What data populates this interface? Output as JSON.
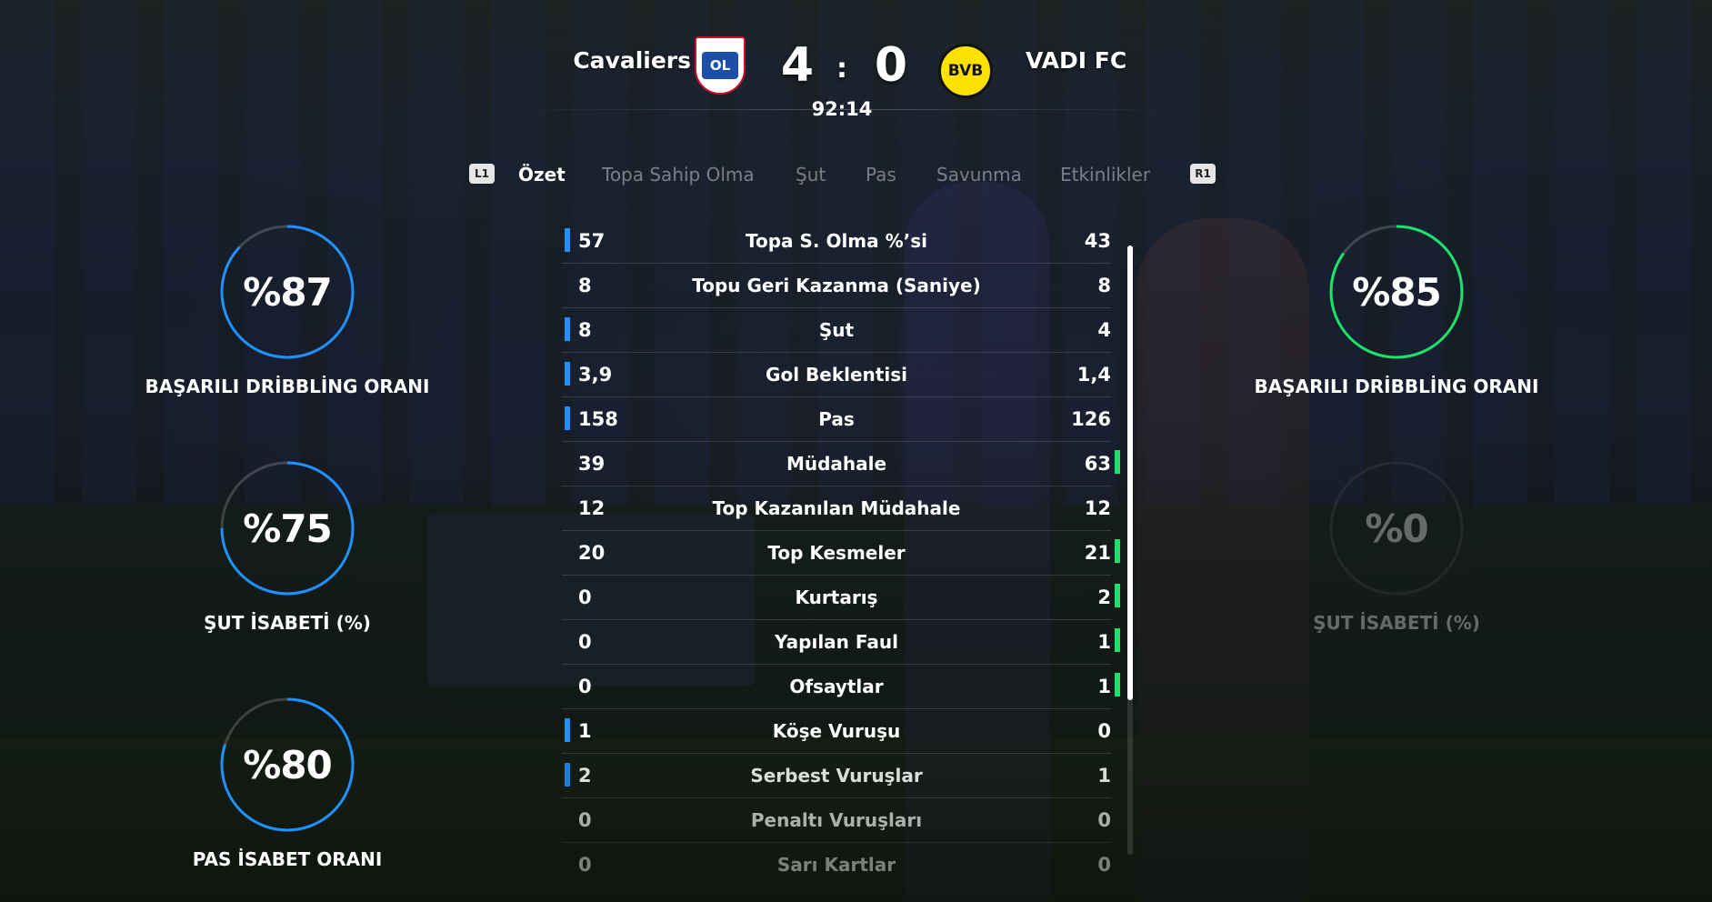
{
  "match": {
    "home_team": "Cavaliers",
    "home_crest_text": "OL",
    "home_score": "4",
    "separator": ":",
    "away_score": "0",
    "away_crest_text": "BVB",
    "away_team": "VADI FC",
    "clock": "92:14"
  },
  "tabs": {
    "left_hint": "L1",
    "right_hint": "R1",
    "items": [
      "Özet",
      "Topa Sahip Olma",
      "Şut",
      "Pas",
      "Savunma",
      "Etkinlikler"
    ],
    "active_index": 0
  },
  "home_rings": [
    {
      "value": "%87",
      "label": "BAŞARILI DRİBBLİNG ORANI",
      "fraction": 0.87
    },
    {
      "value": "%75",
      "label": "ŞUT İSABETİ (%)",
      "fraction": 0.75
    },
    {
      "value": "%80",
      "label": "PAS İSABET ORANI",
      "fraction": 0.8
    }
  ],
  "away_rings": [
    {
      "value": "%85",
      "label": "BAŞARILI DRİBBLİNG ORANI",
      "fraction": 0.85
    },
    {
      "value": "%0",
      "label": "ŞUT İSABETİ (%)",
      "fraction": 0.0
    }
  ],
  "stats": [
    {
      "label": "Topa S. Olma %’si",
      "home": "57",
      "away": "43",
      "leader": "home"
    },
    {
      "label": "Topu Geri Kazanma (Saniye)",
      "home": "8",
      "away": "8",
      "leader": "none"
    },
    {
      "label": "Şut",
      "home": "8",
      "away": "4",
      "leader": "home"
    },
    {
      "label": "Gol Beklentisi",
      "home": "3,9",
      "away": "1,4",
      "leader": "home"
    },
    {
      "label": "Pas",
      "home": "158",
      "away": "126",
      "leader": "home"
    },
    {
      "label": "Müdahale",
      "home": "39",
      "away": "63",
      "leader": "away"
    },
    {
      "label": "Top Kazanılan Müdahale",
      "home": "12",
      "away": "12",
      "leader": "none"
    },
    {
      "label": "Top Kesmeler",
      "home": "20",
      "away": "21",
      "leader": "away"
    },
    {
      "label": "Kurtarış",
      "home": "0",
      "away": "2",
      "leader": "away"
    },
    {
      "label": "Yapılan Faul",
      "home": "0",
      "away": "1",
      "leader": "away"
    },
    {
      "label": "Ofsaytlar",
      "home": "0",
      "away": "1",
      "leader": "away"
    },
    {
      "label": "Köşe Vuruşu",
      "home": "1",
      "away": "0",
      "leader": "home"
    },
    {
      "label": "Serbest Vuruşlar",
      "home": "2",
      "away": "1",
      "leader": "home"
    },
    {
      "label": "Penaltı Vuruşları",
      "home": "0",
      "away": "0",
      "leader": "none"
    },
    {
      "label": "Sarı Kartlar",
      "home": "0",
      "away": "0",
      "leader": "none"
    }
  ],
  "colors": {
    "home_accent": "#1e90ff",
    "away_accent": "#19e36a",
    "ring_track": "rgba(255,255,255,0.18)"
  }
}
